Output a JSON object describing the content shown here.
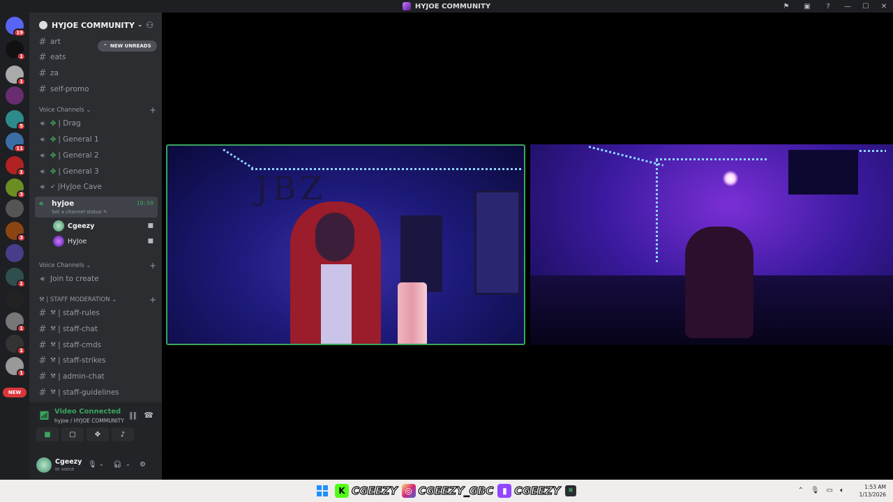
{
  "window": {
    "title": "HYJOE COMMUNITY"
  },
  "servers": {
    "home_badge": "19",
    "badges": [
      "1",
      "1",
      "5",
      "11",
      "1",
      "3",
      "3",
      "1",
      "1",
      "1",
      "1"
    ],
    "new_label": "NEW"
  },
  "guild": {
    "name": "HYJOE COMMUNITY"
  },
  "new_unreads": "NEW UNREADS",
  "text_channels": [
    "art",
    "eats",
    "za",
    "self-promo"
  ],
  "voice_category_1": "Voice Channels",
  "voice_channels": [
    "| Drag",
    "| General 1",
    "| General 2",
    "| General 3",
    "|HyJoe Cave"
  ],
  "active_voice": {
    "name": "hyjoe",
    "status": "Set a channel status",
    "time": "10:59"
  },
  "voice_users": [
    {
      "name": "Cgeezy",
      "avatar_color": "#74c69d"
    },
    {
      "name": "HyJoe",
      "avatar_color": "#7b2fd6"
    }
  ],
  "voice_category_2": "Voice Channels",
  "join_to_create": "Join to create",
  "staff_category": "| STAFF MODERATION",
  "staff_channels": [
    "| staff-rules",
    "| staff-chat",
    "| staff-cmds",
    "| staff-strikes",
    "| admin-chat",
    "| staff-guidelines"
  ],
  "voice_connection": {
    "status": "Video Connected",
    "location": "hyjoe / HYJOE COMMUNITY"
  },
  "user": {
    "name": "Cgeezy",
    "status": "In voice"
  },
  "taskbar": {
    "overlay": [
      "CGEEZY",
      "CGEEZY_GBC",
      "CGEEZY"
    ],
    "time": "1:53 AM",
    "date": "1/13/2026"
  },
  "colors": {
    "accent_green": "#3ba55d",
    "badge_red": "#da373c",
    "sidebar": "#2b2d31",
    "rail": "#1e1f22"
  }
}
